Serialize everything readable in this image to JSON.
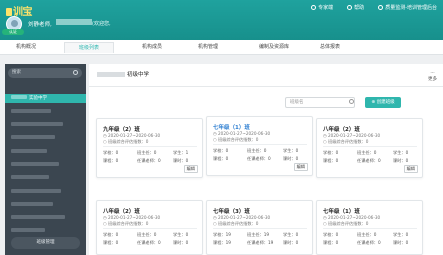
{
  "header": {
    "logo": "训宝",
    "user_name": "刘静老师,",
    "user_sub": "(欢迎您,",
    "avatar_badge": "认证",
    "links": [
      {
        "label": "专家端",
        "icon": "user-icon"
      },
      {
        "label": "帮助",
        "icon": "help-icon"
      },
      {
        "label": "质量监测-培训管理后台",
        "icon": "settings-icon"
      }
    ]
  },
  "nav": {
    "tabs": [
      "机构概况",
      "班级列表",
      "机构成员",
      "机构管理",
      "编制及资源库",
      "总体报表"
    ],
    "active": 1
  },
  "sidebar": {
    "search_placeholder": "搜索",
    "active_label": "实验中学",
    "bottom_button": "班级管理"
  },
  "main": {
    "title": "初级中学",
    "more_label": "更多",
    "search_placeholder": "班级名",
    "create_label": "创建班级",
    "cards": [
      {
        "title": "九年级（2）班",
        "date": "2020-01-27~2020-06-30",
        "note": "班级综合评估指数：0",
        "stats": [
          "学校：0",
          "班主任：0",
          "学生：1",
          "课程：0",
          "任课老师：0",
          "课时：0"
        ],
        "action": "编辑"
      },
      {
        "title": "七年级（1）班",
        "date": "2020-01-27~2020-06-30",
        "note": "班级综合评估指数：0",
        "stats": [
          "学校：0",
          "班主任：0",
          "学生：0",
          "课程：0",
          "任课老师：0",
          "课时：0"
        ],
        "action": "编辑"
      },
      {
        "title": "八年级（2）班",
        "date": "2020-01-27~2020-06-30",
        "note": "班级综合评估指数：0",
        "stats": [
          "学校：0",
          "班主任：0",
          "学生：0",
          "课程：0",
          "任课老师：0",
          "课时：0"
        ],
        "action": "编辑"
      },
      {
        "title": "八年级（2）班",
        "date": "2020-01-27~2020-06-30",
        "note": "班级综合评估指数：0",
        "stats": [
          "学校：0",
          "班主任：0",
          "学生：0",
          "课程：0",
          "任课老师：0",
          "课时：0"
        ],
        "action": "编辑"
      },
      {
        "title": "七年级（3）班",
        "date": "2020-01-27~2020-06-30",
        "note": "班级综合评估指数：0",
        "stats": [
          "学校：19",
          "班主任：19",
          "学生：0",
          "课程：19",
          "任课老师：19",
          "课时：0"
        ],
        "action": "编辑"
      },
      {
        "title": "七年级（1）班",
        "date": "2020-01-27~2020-06-30",
        "note": "班级综合评估指数：0",
        "stats": [
          "学校：0",
          "班主任：0",
          "学生：0",
          "课程：0",
          "任课老师：0",
          "课时：0"
        ],
        "action": "编辑"
      }
    ]
  },
  "colors": {
    "header": "#1fa29e",
    "accent": "#2fb6ad",
    "sidebar": "#3b4650",
    "highlight_title": "#2f7fd1"
  }
}
